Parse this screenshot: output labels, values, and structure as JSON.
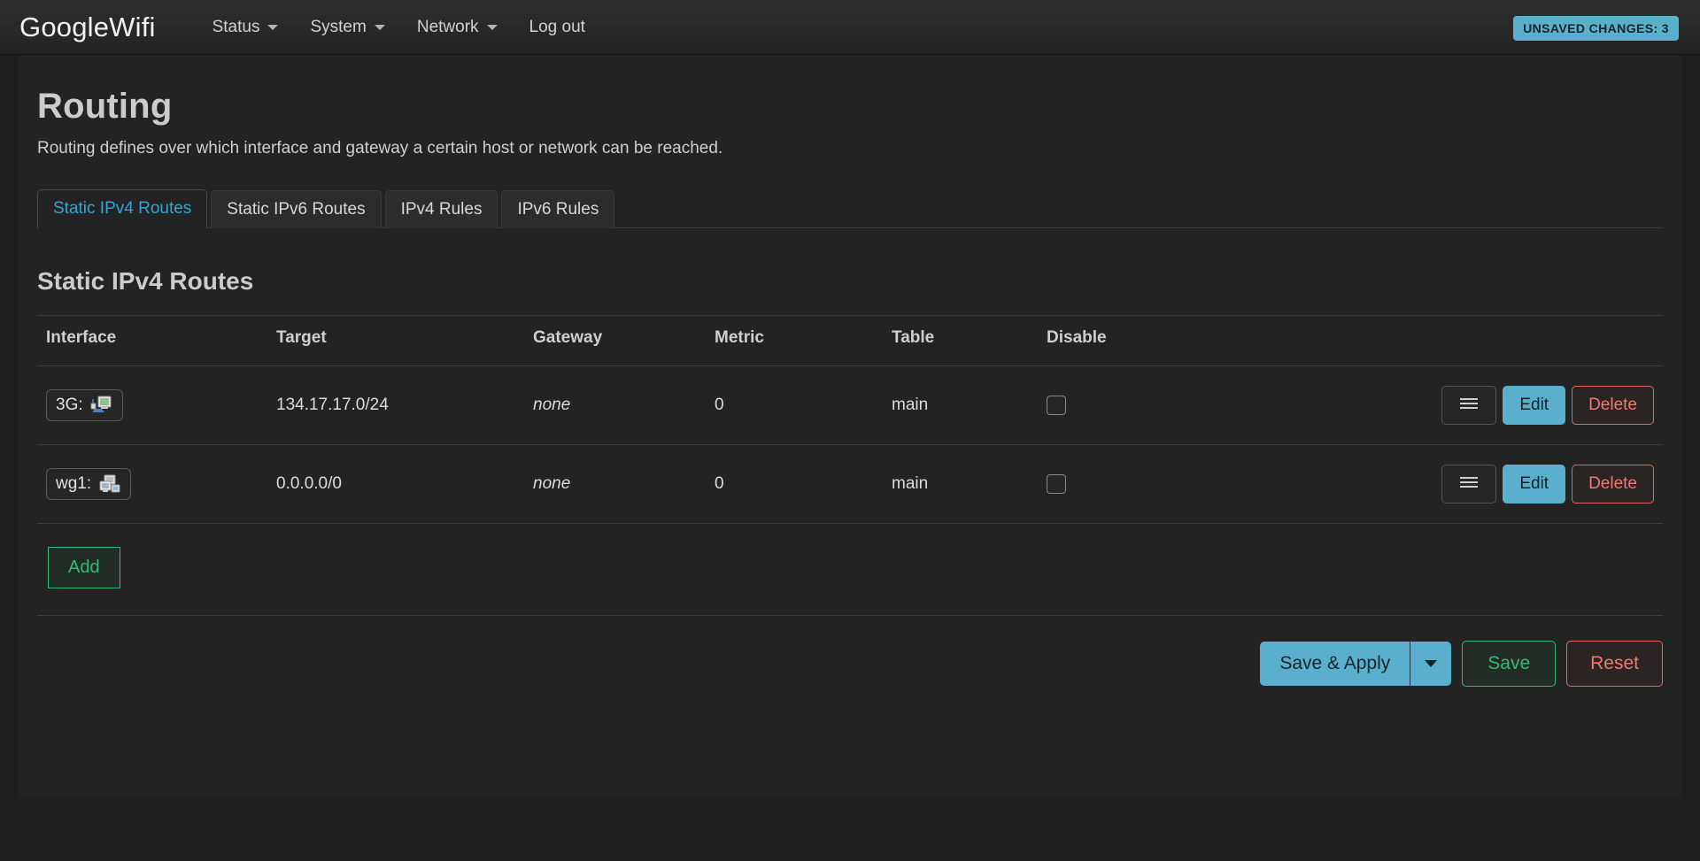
{
  "header": {
    "brand": "GoogleWifi",
    "nav": [
      {
        "label": "Status",
        "icon": "chevron-down-icon",
        "has_caret": true
      },
      {
        "label": "System",
        "icon": "chevron-down-icon",
        "has_caret": true
      },
      {
        "label": "Network",
        "icon": "chevron-down-icon",
        "has_caret": true
      },
      {
        "label": "Log out",
        "icon": "",
        "has_caret": false
      }
    ],
    "unsaved_badge": "UNSAVED CHANGES: 3",
    "badge_color": "#5aafcc"
  },
  "page": {
    "title": "Routing",
    "description": "Routing defines over which interface and gateway a certain host or network can be reached."
  },
  "tabs": [
    {
      "label": "Static IPv4 Routes",
      "active": true
    },
    {
      "label": "Static IPv6 Routes",
      "active": false
    },
    {
      "label": "IPv4 Rules",
      "active": false
    },
    {
      "label": "IPv6 Rules",
      "active": false
    }
  ],
  "section": {
    "title": "Static IPv4 Routes"
  },
  "table": {
    "columns": [
      "Interface",
      "Target",
      "Gateway",
      "Metric",
      "Table",
      "Disable"
    ],
    "rows": [
      {
        "interface": "3G:",
        "interface_icon": "modem-3g-icon",
        "target": "134.17.17.0/24",
        "gateway": "none",
        "metric": "0",
        "routing_table": "main",
        "disable_checked": false,
        "handle_label": "≡",
        "edit_label": "Edit",
        "delete_label": "Delete"
      },
      {
        "interface": "wg1:",
        "interface_icon": "tunnel-interface-icon",
        "target": "0.0.0.0/0",
        "gateway": "none",
        "metric": "0",
        "routing_table": "main",
        "disable_checked": false,
        "handle_label": "≡",
        "edit_label": "Edit",
        "delete_label": "Delete"
      }
    ],
    "add_label": "Add"
  },
  "footer": {
    "save_apply_label": "Save & Apply",
    "save_label": "Save",
    "reset_label": "Reset"
  },
  "colors": {
    "accent_blue": "#5aafcc",
    "accent_green": "#2fbd72",
    "accent_red": "#ef7a70",
    "tab_active_text": "#2fa8d8",
    "page_bg": "#1f1f1f",
    "card_bg": "#232323"
  }
}
